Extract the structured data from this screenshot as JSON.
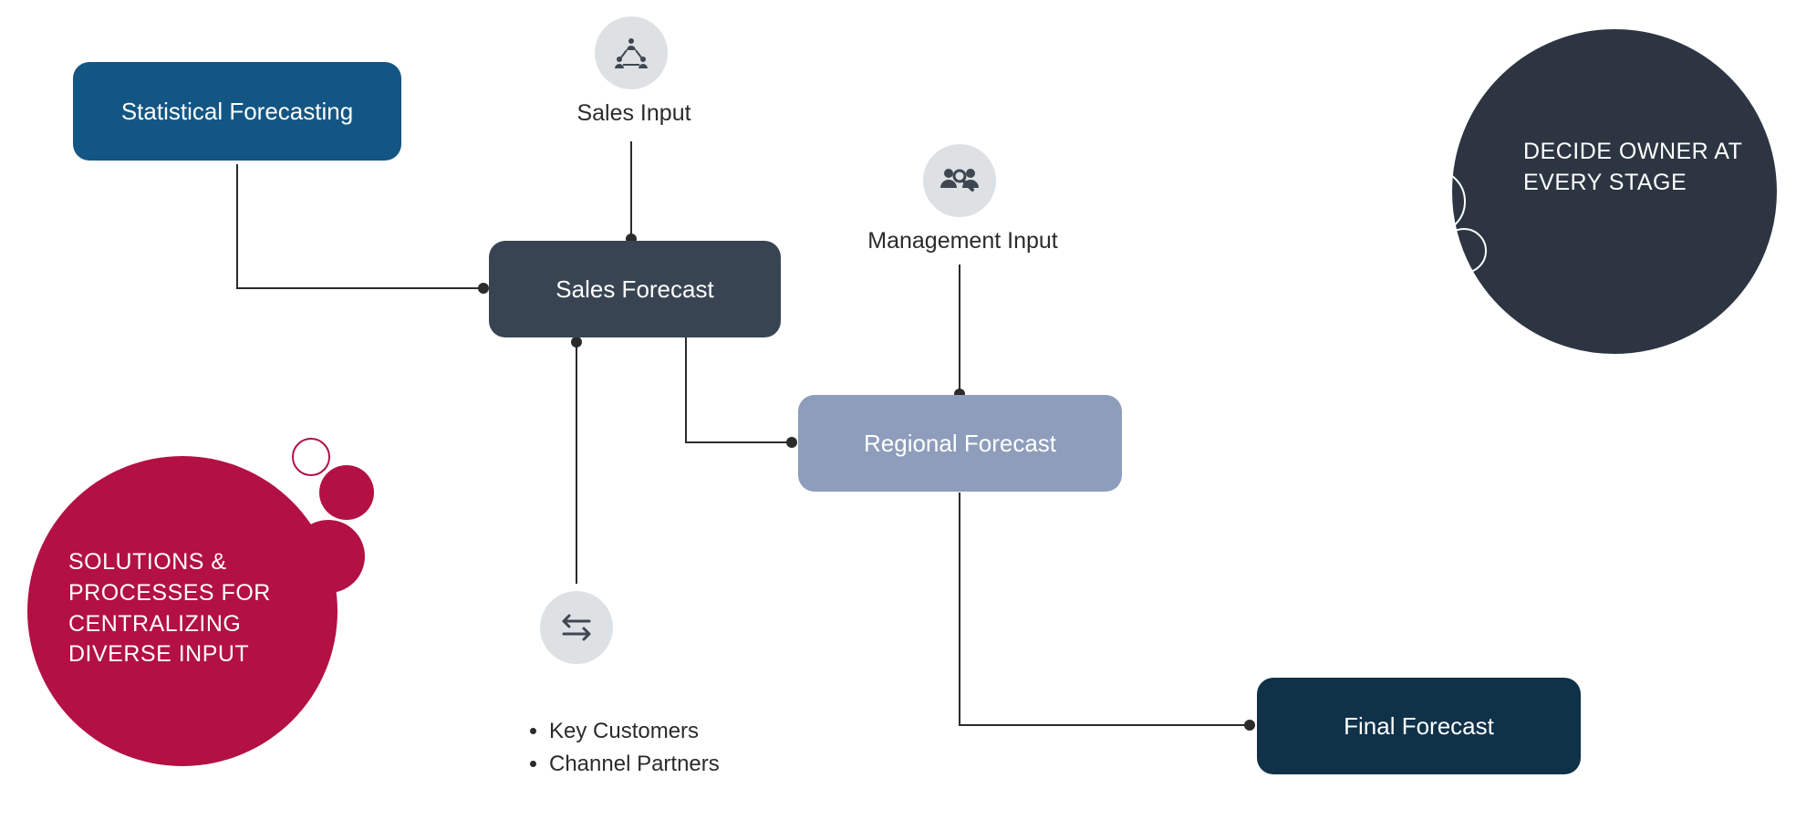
{
  "nodes": {
    "statistical_forecasting": {
      "label": "Statistical Forecasting",
      "color": "#135684"
    },
    "sales_forecast": {
      "label": "Sales Forecast",
      "color": "#394453"
    },
    "regional_forecast": {
      "label": "Regional Forecast",
      "color": "#8d9dbb"
    },
    "final_forecast": {
      "label": "Final Forecast",
      "color": "#103249"
    }
  },
  "inputs": {
    "sales_input": {
      "label": "Sales Input"
    },
    "management_input": {
      "label": "Management Input"
    },
    "external_input": {
      "bullets": [
        "Key Customers",
        "Channel Partners"
      ]
    }
  },
  "bubbles": {
    "left": {
      "text": "SOLUTIONS & PROCESSES FOR CENTRALIZING DIVERSE INPUT",
      "color": "#b31044"
    },
    "right": {
      "text": "DECIDE OWNER AT EVERY STAGE",
      "color": "#2c3541"
    }
  },
  "icons": {
    "sales_input": "network-icon",
    "management_input": "team-magnifier-icon",
    "external_input": "arrows-exchange-icon"
  }
}
